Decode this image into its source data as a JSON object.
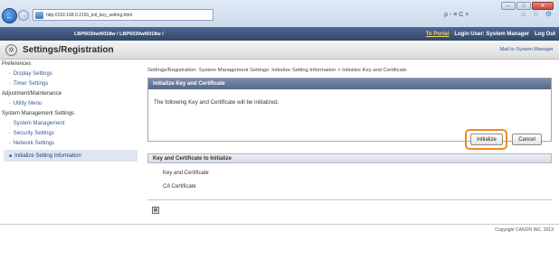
{
  "browser": {
    "url": "http://192.168.0.215/i_init_key_setting.html",
    "addr_tools": "ρ - ≡ C ×"
  },
  "header": {
    "model": "LBP6030w/6018w / LBP6030w/6018w /",
    "to_portal": "To Portal",
    "login_user": "Login User: System Manager",
    "logout": "Log Out"
  },
  "title": {
    "page_title": "Settings/Registration",
    "mail_link": "Mail to System Manager"
  },
  "sidebar": {
    "items": [
      {
        "label": "Preferences",
        "type": "header"
      },
      {
        "label": "Display Settings",
        "type": "link"
      },
      {
        "label": "Timer Settings",
        "type": "link"
      },
      {
        "label": "Adjustment/Maintenance",
        "type": "header"
      },
      {
        "label": "Utility Menu",
        "type": "link"
      },
      {
        "label": "System Management Settings",
        "type": "header"
      },
      {
        "label": "System Management",
        "type": "link"
      },
      {
        "label": "Security Settings",
        "type": "link"
      },
      {
        "label": "Network Settings",
        "type": "link"
      },
      {
        "label": "Initialize Setting Information",
        "type": "active"
      }
    ]
  },
  "main": {
    "breadcrumb": "Settings/Registration: System Management Settings: Initialize Setting Information > Initialize Key and Certificate",
    "panel_title": "Initialize Key and Certificate",
    "message": "The following Key and Certificate will be initialized.",
    "initialize_label": "Initialize",
    "cancel_label": "Cancel",
    "list_header": "Key and Certificate to Initialize",
    "list_items": [
      "Key and Certificate",
      "CA Certificate"
    ]
  },
  "footer": {
    "copyright": "Copyright CANON INC. 2013"
  },
  "colors": {
    "header_bar": "#3d5478",
    "accent_orange": "#f08a1e",
    "link": "#3a5a92"
  }
}
